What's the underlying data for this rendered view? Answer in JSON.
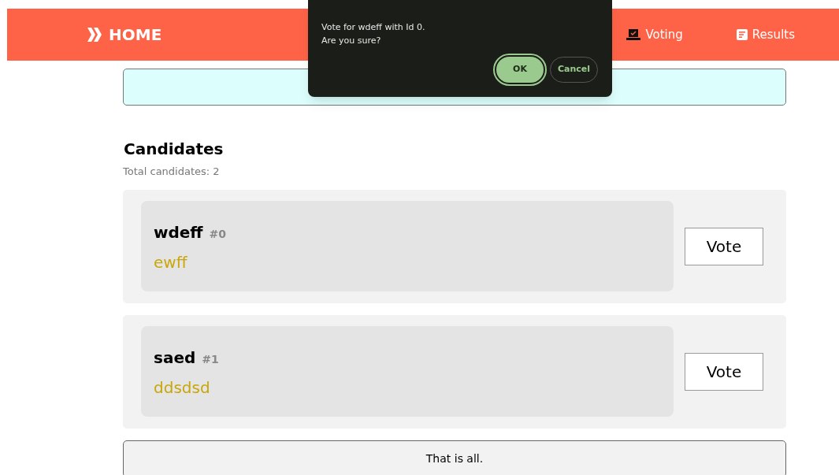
{
  "header": {
    "brand": "HOME",
    "nav": [
      {
        "label": "Voting",
        "kind": "ballot"
      },
      {
        "label": "Results",
        "kind": "list"
      }
    ]
  },
  "dialog": {
    "lines": [
      "Vote for wdeff with Id 0.",
      "Are you sure?"
    ],
    "ok": "OK",
    "cancel": "Cancel"
  },
  "candidates": {
    "title": "Candidates",
    "total": "Total candidates: 2",
    "items": [
      {
        "name": "wdeff",
        "id": "#0",
        "description": "ewff",
        "button": "Vote"
      },
      {
        "name": "saed",
        "id": "#1",
        "description": "ddsdsd",
        "button": "Vote"
      }
    ]
  },
  "footer": "That is all."
}
